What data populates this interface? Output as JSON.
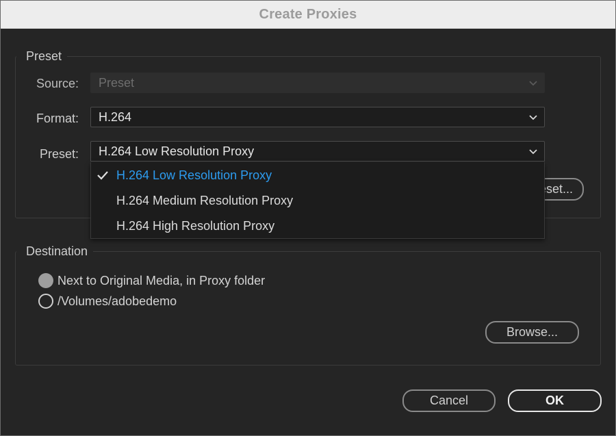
{
  "window": {
    "title": "Create Proxies"
  },
  "preset_group": {
    "label": "Preset",
    "source": {
      "label": "Source:",
      "value": "Preset",
      "disabled": true
    },
    "format": {
      "label": "Format:",
      "value": "H.264"
    },
    "preset": {
      "label": "Preset:",
      "value": "H.264 Low Resolution Proxy",
      "options": [
        {
          "label": "H.264 Low Resolution Proxy",
          "selected": true
        },
        {
          "label": "H.264 Medium Resolution Proxy",
          "selected": false
        },
        {
          "label": "H.264 High Resolution Proxy",
          "selected": false
        }
      ]
    },
    "hidden_button_partial": "eset..."
  },
  "destination_group": {
    "label": "Destination",
    "options": [
      {
        "label": "Next to Original Media, in Proxy folder",
        "selected": true
      },
      {
        "label": "/Volumes/adobedemo",
        "selected": false
      }
    ],
    "browse_label": "Browse..."
  },
  "footer": {
    "cancel_label": "Cancel",
    "ok_label": "OK"
  },
  "colors": {
    "accent_selected": "#2d9cf0",
    "background": "#252525",
    "titlebar": "#ededed"
  }
}
